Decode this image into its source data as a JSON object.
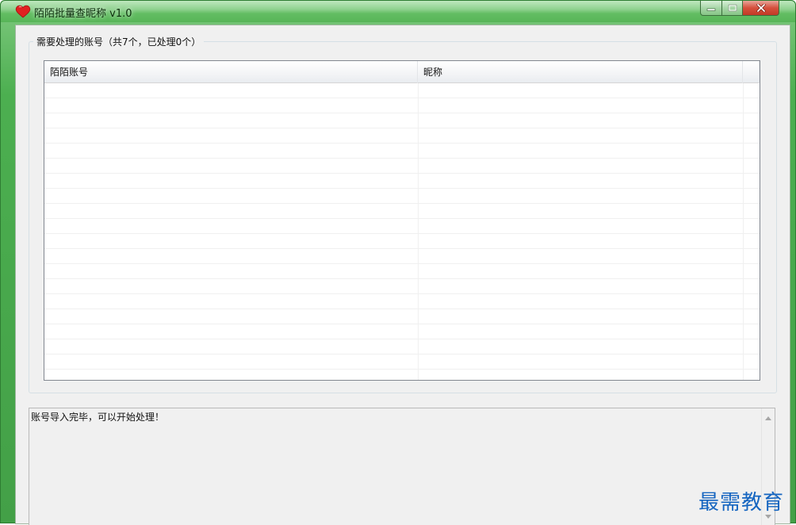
{
  "window": {
    "title": "陌陌批量查昵称 v1.0",
    "icon": "heart-icon"
  },
  "caption": {
    "minimize_icon": "minimize-icon",
    "maximize_icon": "maximize-icon",
    "close_icon": "close-icon"
  },
  "group": {
    "legend": "需要处理的账号（共7个，已处理0个）"
  },
  "table": {
    "columns": [
      "陌陌账号",
      "昵称"
    ],
    "rows": []
  },
  "log": {
    "text": "账号导入完毕，可以开始处理！"
  },
  "watermark": "最需教育",
  "colors": {
    "frame_green": "#4caf50",
    "close_red": "#d5503c",
    "watermark_blue": "#1565c0"
  }
}
